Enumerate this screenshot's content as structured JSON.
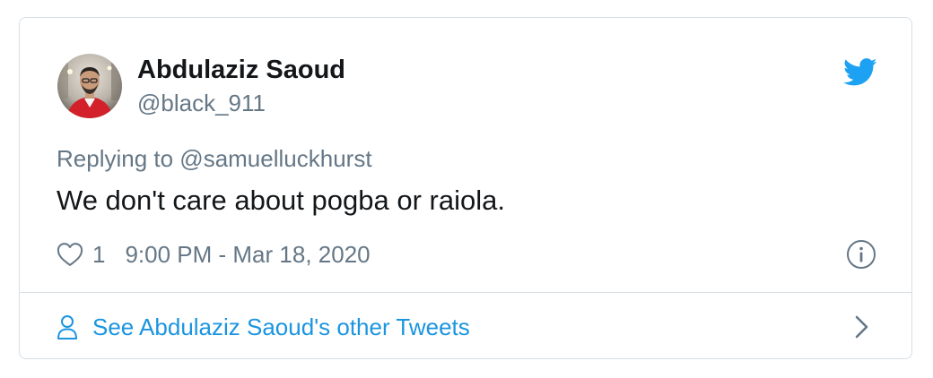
{
  "tweet": {
    "author_name": "Abdulaziz Saoud",
    "author_handle": "@black_911",
    "replying_to": "Replying to @samuelluckhurst",
    "text": "We don't care about pogba or raiola.",
    "like_count": "1",
    "timestamp": "9:00 PM - Mar 18, 2020"
  },
  "footer": {
    "link_label": "See Abdulaziz Saoud's other Tweets"
  },
  "icons": {
    "brand": "twitter-bird-icon",
    "like": "heart-icon",
    "info": "info-icon",
    "profile": "person-icon",
    "next": "chevron-right-icon"
  },
  "colors": {
    "brand_blue": "#1da1f2",
    "link_blue": "#1b95e0",
    "secondary_text": "#657786",
    "primary_text": "#14171a",
    "border": "#d9dee3"
  }
}
